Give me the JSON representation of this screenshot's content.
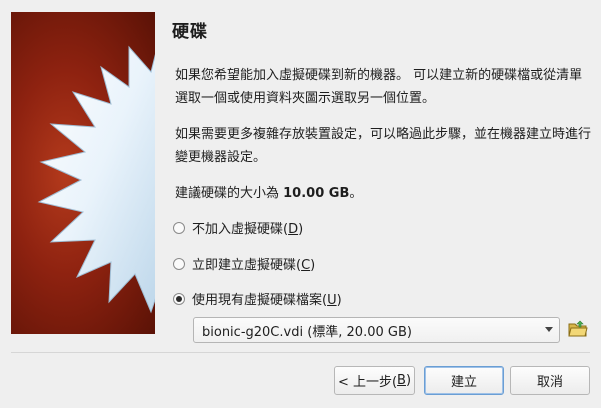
{
  "title": "硬碟",
  "paragraph1": "如果您希望能加入虛擬硬碟到新的機器。 可以建立新的硬碟檔或從清單選取一個或使用資料夾圖示選取另一個位置。",
  "paragraph2": "如果需要更多複雜存放裝置設定，可以略過此步驟，並在機器建立時進行變更機器設定。",
  "recommend_prefix": "建議硬碟的大小為 ",
  "recommend_size": "10.00 GB",
  "recommend_suffix": "。",
  "options": [
    {
      "label": "不加入虛擬硬碟(",
      "key": "D",
      "end": ")",
      "checked": false
    },
    {
      "label": "立即建立虛擬硬碟(",
      "key": "C",
      "end": ")",
      "checked": false
    },
    {
      "label": "使用現有虛擬硬碟檔案(",
      "key": "U",
      "end": ")",
      "checked": true
    }
  ],
  "disk_select": {
    "value": "bionic-g20C.vdi (標準, 20.00 GB)"
  },
  "buttons": {
    "back_prefix": "< 上一步(",
    "back_key": "B",
    "back_suffix": ")",
    "create": "建立",
    "cancel": "取消"
  },
  "icons": {
    "side_image": "starburst-banner",
    "folder": "folder-open-icon"
  }
}
